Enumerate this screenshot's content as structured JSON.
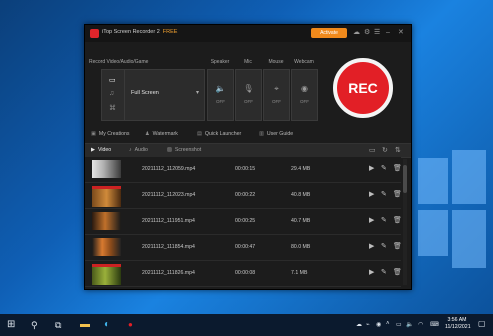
{
  "app": {
    "title": "iTop Screen Recorder 2",
    "badge": "FREE",
    "activate_label": "Activate"
  },
  "capture": {
    "section_label": "Record Video/Audio/Game",
    "mode_value": "Full Screen",
    "sources": [
      {
        "label": "Speaker",
        "state": "OFF",
        "icon": "speaker-icon"
      },
      {
        "label": "Mic",
        "state": "OFF",
        "icon": "mic-icon"
      },
      {
        "label": "Mouse",
        "state": "OFF",
        "icon": "mouse-icon"
      },
      {
        "label": "Webcam",
        "state": "OFF",
        "icon": "webcam-icon"
      }
    ],
    "rec_label": "REC"
  },
  "nav": {
    "items": [
      "My Creations",
      "Watermark",
      "Quick Launcher",
      "User Guide"
    ]
  },
  "tabs": [
    "Video",
    "Audio",
    "Screenshot"
  ],
  "recordings": [
    {
      "name": "20211112_112059.mp4",
      "duration": "00:00:15",
      "size": "29.4 MB"
    },
    {
      "name": "20211112_112023.mp4",
      "duration": "00:00:22",
      "size": "40.8 MB"
    },
    {
      "name": "20211112_111951.mp4",
      "duration": "00:00:25",
      "size": "40.7 MB"
    },
    {
      "name": "20211112_111854.mp4",
      "duration": "00:00:47",
      "size": "80.0 MB"
    },
    {
      "name": "20211112_111826.mp4",
      "duration": "00:00:08",
      "size": "7.1 MB"
    }
  ],
  "taskbar": {
    "time": "3:56 AM",
    "date": "11/12/2021"
  },
  "colors": {
    "accent_orange": "#f08a1c",
    "rec_red": "#e21f26",
    "app_bg": "#1c1c1c",
    "desktop_blue": "#0f5fb5"
  }
}
